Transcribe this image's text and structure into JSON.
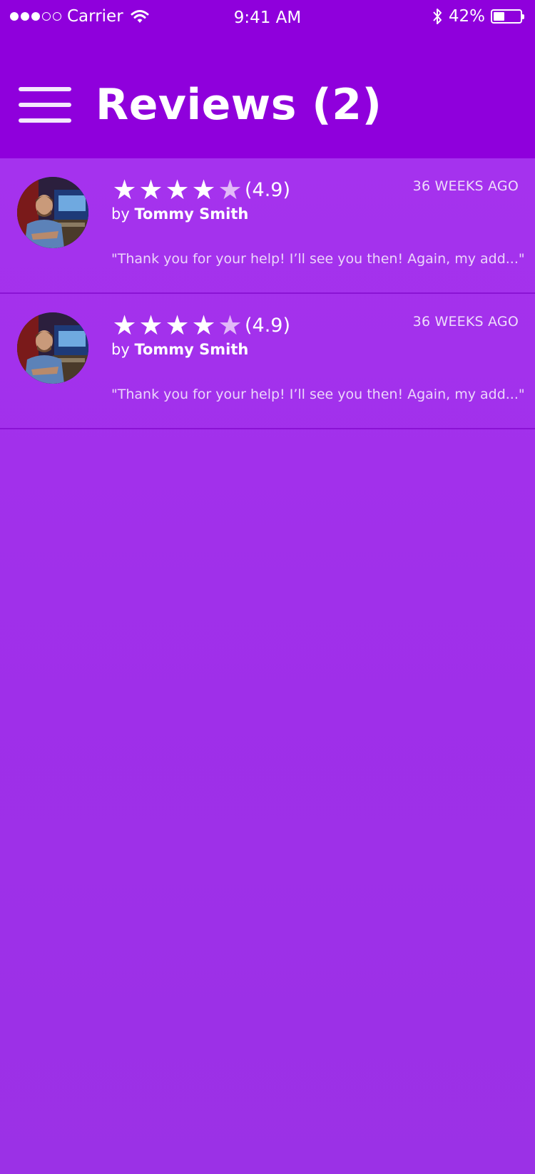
{
  "status_bar": {
    "carrier": "Carrier",
    "time": "9:41 AM",
    "battery_percent": "42%",
    "battery_level": 0.42,
    "signal_bars_filled": 3,
    "signal_bars_total": 5
  },
  "header": {
    "title": "Reviews (2)",
    "menu_icon": "hamburger-menu-icon",
    "background": "#8f00dc"
  },
  "colors": {
    "page_background": "#a733ef",
    "divider": "#8a13d4",
    "star_full": "#ffffff",
    "star_partial": "#e2b9f8"
  },
  "reviews": [
    {
      "stars": [
        "★",
        "★",
        "★",
        "★",
        "★"
      ],
      "rating": "(4.9)",
      "time_ago": "36 WEEKS AGO",
      "by_label": "by",
      "author": "Tommy Smith",
      "text": "\"Thank you for your help! I’ll see you then! Again, my add...\""
    },
    {
      "stars": [
        "★",
        "★",
        "★",
        "★",
        "★"
      ],
      "rating": "(4.9)",
      "time_ago": "36 WEEKS AGO",
      "by_label": "by",
      "author": "Tommy Smith",
      "text": "\"Thank you for your help! I’ll see you then! Again, my add...\""
    }
  ]
}
